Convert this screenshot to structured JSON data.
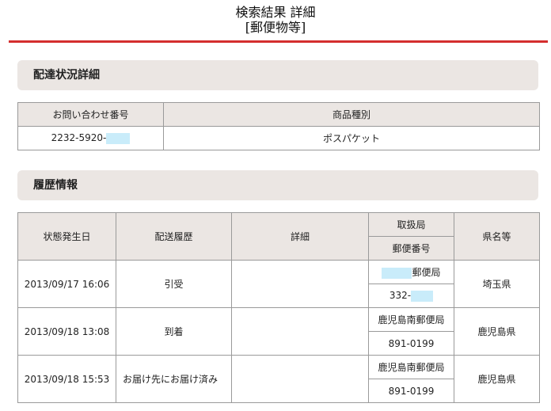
{
  "page": {
    "title_line1": "検索結果 詳細",
    "title_line2": "[郵便物等]",
    "accent_color": "#d42e2e",
    "section_bg": "#ebe6e3",
    "redaction_color": "#c9ecfa"
  },
  "delivery_status": {
    "heading": "配達状況詳細",
    "columns": [
      "お問い合わせ番号",
      "商品種別"
    ],
    "tracking_number_prefix": "2232-5920-",
    "product_type": "ポスパケット"
  },
  "history": {
    "heading": "履歴情報",
    "columns": {
      "date": "状態発生日",
      "event": "配送履歴",
      "detail": "詳細",
      "office": "取扱局",
      "postal_code": "郵便番号",
      "prefecture": "県名等"
    },
    "rows": [
      {
        "date": "2013/09/17 16:06",
        "event": "引受",
        "detail": "",
        "office": "郵便局",
        "postal_code": "332-",
        "prefecture": "埼玉県"
      },
      {
        "date": "2013/09/18 13:08",
        "event": "到着",
        "detail": "",
        "office": "鹿児島南郵便局",
        "postal_code": "891-0199",
        "prefecture": "鹿児島県"
      },
      {
        "date": "2013/09/18 15:53",
        "event": "お届け先にお届け済み",
        "detail": "",
        "office": "鹿児島南郵便局",
        "postal_code": "891-0199",
        "prefecture": "鹿児島県"
      }
    ]
  }
}
